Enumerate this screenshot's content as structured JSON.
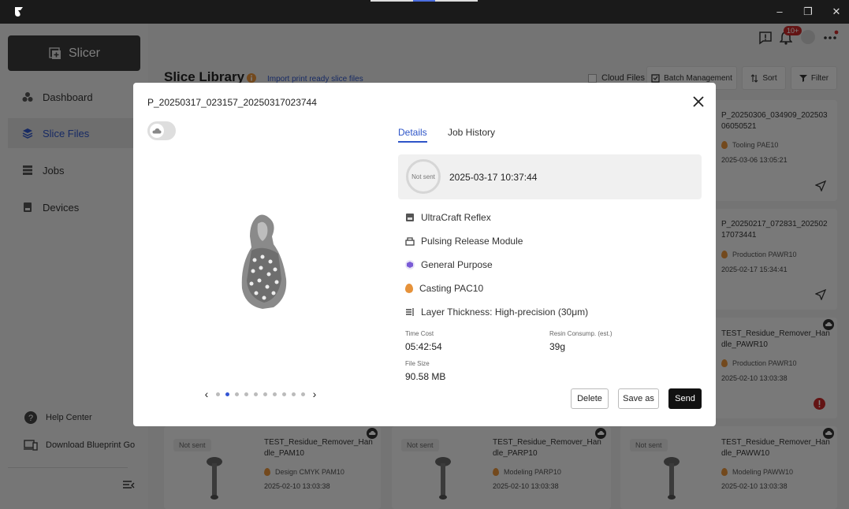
{
  "window": {
    "minimize": "–",
    "restore": "❐",
    "close": "✕"
  },
  "sidebar": {
    "slicer_label": "Slicer",
    "items": [
      {
        "label": "Dashboard"
      },
      {
        "label": "Slice Files"
      },
      {
        "label": "Jobs"
      },
      {
        "label": "Devices"
      }
    ],
    "help_center": "Help Center",
    "download": "Download Blueprint Go"
  },
  "header": {
    "title": "Slice Library",
    "import_link": "Import print ready slice files",
    "notif_count": "10+",
    "cloud_files": "Cloud Files",
    "batch": "Batch Management",
    "sort": "Sort",
    "filter": "Filter"
  },
  "cards": [
    {
      "name": "P_20250306_034909_20250306050521",
      "material": "Tooling PAE10",
      "date": "2025-03-06 13:05:21"
    },
    {
      "name": "P_20250217_072831_20250217073441",
      "material": "Production PAWR10",
      "date": "2025-02-17 15:34:41"
    },
    {
      "name": "TEST_Residue_Remover_Handle_PAWR10",
      "material": "Production PAWR10",
      "date": "2025-02-10 13:03:38"
    },
    {
      "status": "Not sent",
      "name": "TEST_Residue_Remover_Handle_PAM10",
      "material": "Design CMYK PAM10",
      "date": "2025-02-10 13:03:38"
    },
    {
      "status": "Not sent",
      "name": "TEST_Residue_Remover_Handle_PARP10",
      "material": "Modeling PARP10",
      "date": "2025-02-10 13:03:38"
    },
    {
      "status": "Not sent",
      "name": "TEST_Residue_Remover_Handle_PAWW10",
      "material": "Modeling PAWW10",
      "date": "2025-02-10 13:03:38"
    }
  ],
  "modal": {
    "title": "P_20250317_023157_20250317023744",
    "tabs": [
      "Details",
      "Job History"
    ],
    "status": "Not sent",
    "timestamp": "2025-03-17 10:37:44",
    "specs": [
      "UltraCraft Reflex",
      "Pulsing Release Module",
      "General Purpose",
      "Casting PAC10",
      "Layer Thickness: High-precision (30μm)"
    ],
    "time_cost_label": "Time Cost",
    "time_cost": "05:42:54",
    "resin_label": "Resin Consump. (est.)",
    "resin": "39g",
    "file_size_label": "File Size",
    "file_size": "90.58 MB",
    "delete": "Delete",
    "save_as": "Save as",
    "send": "Send",
    "carousel_total": 10,
    "carousel_active": 2
  }
}
